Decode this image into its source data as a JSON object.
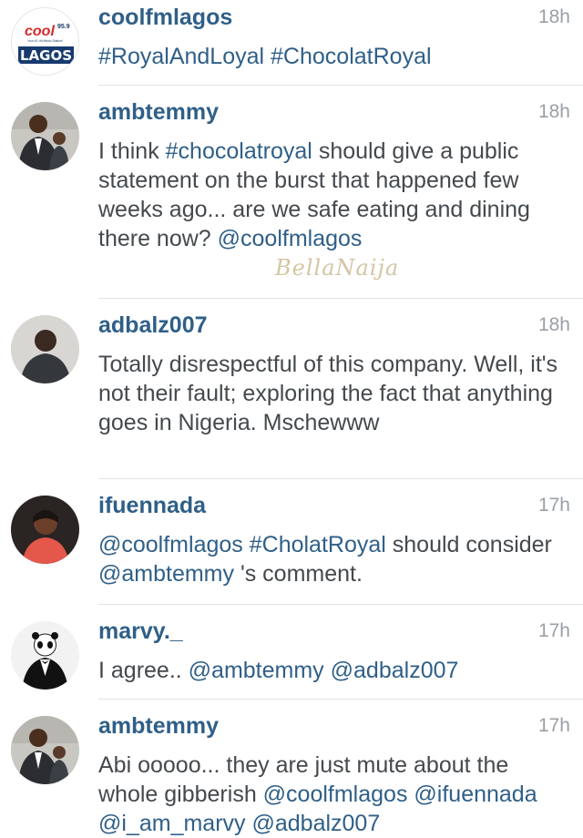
{
  "comments": [
    {
      "username": "coolfmlagos",
      "time": "18h",
      "avatar": "coolfm-lagos-logo",
      "parts": [
        {
          "t": "tag",
          "v": "#RoyalAndLoyal"
        },
        {
          "t": "text",
          "v": " "
        },
        {
          "t": "tag",
          "v": "#ChocolatRoyal"
        }
      ]
    },
    {
      "username": "ambtemmy",
      "time": "18h",
      "avatar": "man-with-child-photo",
      "parts": [
        {
          "t": "text",
          "v": "I think "
        },
        {
          "t": "tag",
          "v": "#chocolatroyal"
        },
        {
          "t": "text",
          "v": " should give a public statement on the burst that happened few weeks ago... are we safe eating and dining there now? "
        },
        {
          "t": "mention",
          "v": "@coolfmlagos"
        }
      ]
    },
    {
      "username": "adbalz007",
      "time": "18h",
      "avatar": "man-photo",
      "parts": [
        {
          "t": "text",
          "v": "Totally disrespectful of this company. Well, it's not their fault; exploring the fact that anything goes in Nigeria. Mschewww"
        }
      ]
    },
    {
      "username": "ifuennada",
      "time": "17h",
      "avatar": "woman-photo",
      "parts": [
        {
          "t": "mention",
          "v": "@coolfmlagos"
        },
        {
          "t": "text",
          "v": " "
        },
        {
          "t": "tag",
          "v": "#CholatRoyal"
        },
        {
          "t": "text",
          "v": " should consider "
        },
        {
          "t": "mention",
          "v": "@ambtemmy"
        },
        {
          "t": "text",
          "v": " 's comment."
        }
      ]
    },
    {
      "username": "marvy._",
      "time": "17h",
      "avatar": "panda-tuxedo-avatar",
      "parts": [
        {
          "t": "text",
          "v": "I agree.. "
        },
        {
          "t": "mention",
          "v": "@ambtemmy"
        },
        {
          "t": "text",
          "v": " "
        },
        {
          "t": "mention",
          "v": "@adbalz007"
        }
      ]
    },
    {
      "username": "ambtemmy",
      "time": "17h",
      "avatar": "man-with-child-photo",
      "parts": [
        {
          "t": "text",
          "v": "Abi ooooo... they are just mute about the whole gibberish "
        },
        {
          "t": "mention",
          "v": "@coolfmlagos"
        },
        {
          "t": "text",
          "v": " "
        },
        {
          "t": "mention",
          "v": "@ifuennada"
        },
        {
          "t": "text",
          "v": " "
        },
        {
          "t": "mention",
          "v": "@i_am_marvy"
        },
        {
          "t": "text",
          "v": " "
        },
        {
          "t": "mention",
          "v": "@adbalz007"
        }
      ]
    }
  ],
  "logo": {
    "cool": "cool",
    "freq": "95.9",
    "tagline": "Your #1 Hit Music Station!",
    "city": "LAGOS"
  },
  "watermark": "BellaNaija",
  "colors": {
    "link": "#2f5f88",
    "body": "#44494d",
    "time": "#9aa0a6",
    "divider": "#e3e3e3"
  }
}
